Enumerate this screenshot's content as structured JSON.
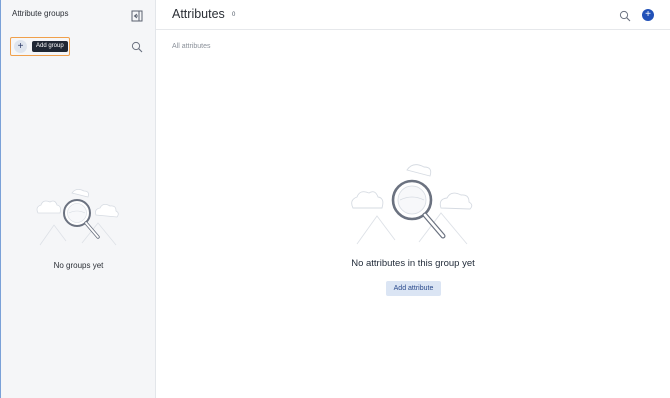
{
  "sidebar": {
    "title": "Attribute groups",
    "add_group_tooltip": "Add group",
    "empty_text": "No groups yet"
  },
  "header": {
    "title": "Attributes",
    "count": "0"
  },
  "main": {
    "breadcrumb": "All attributes",
    "empty_text": "No attributes in this group yet",
    "add_button_label": "Add attribute"
  },
  "icons": {
    "collapse": "collapse-panel-icon",
    "add": "plus-icon",
    "search": "search-icon",
    "illustration": "magnifier-illustration"
  },
  "colors": {
    "accent": "#2251b8",
    "highlight": "#f0a04b",
    "tooltip_bg": "#1f2733",
    "button_bg": "#dbe5f4",
    "sidebar_bg": "#f5f6f8"
  }
}
